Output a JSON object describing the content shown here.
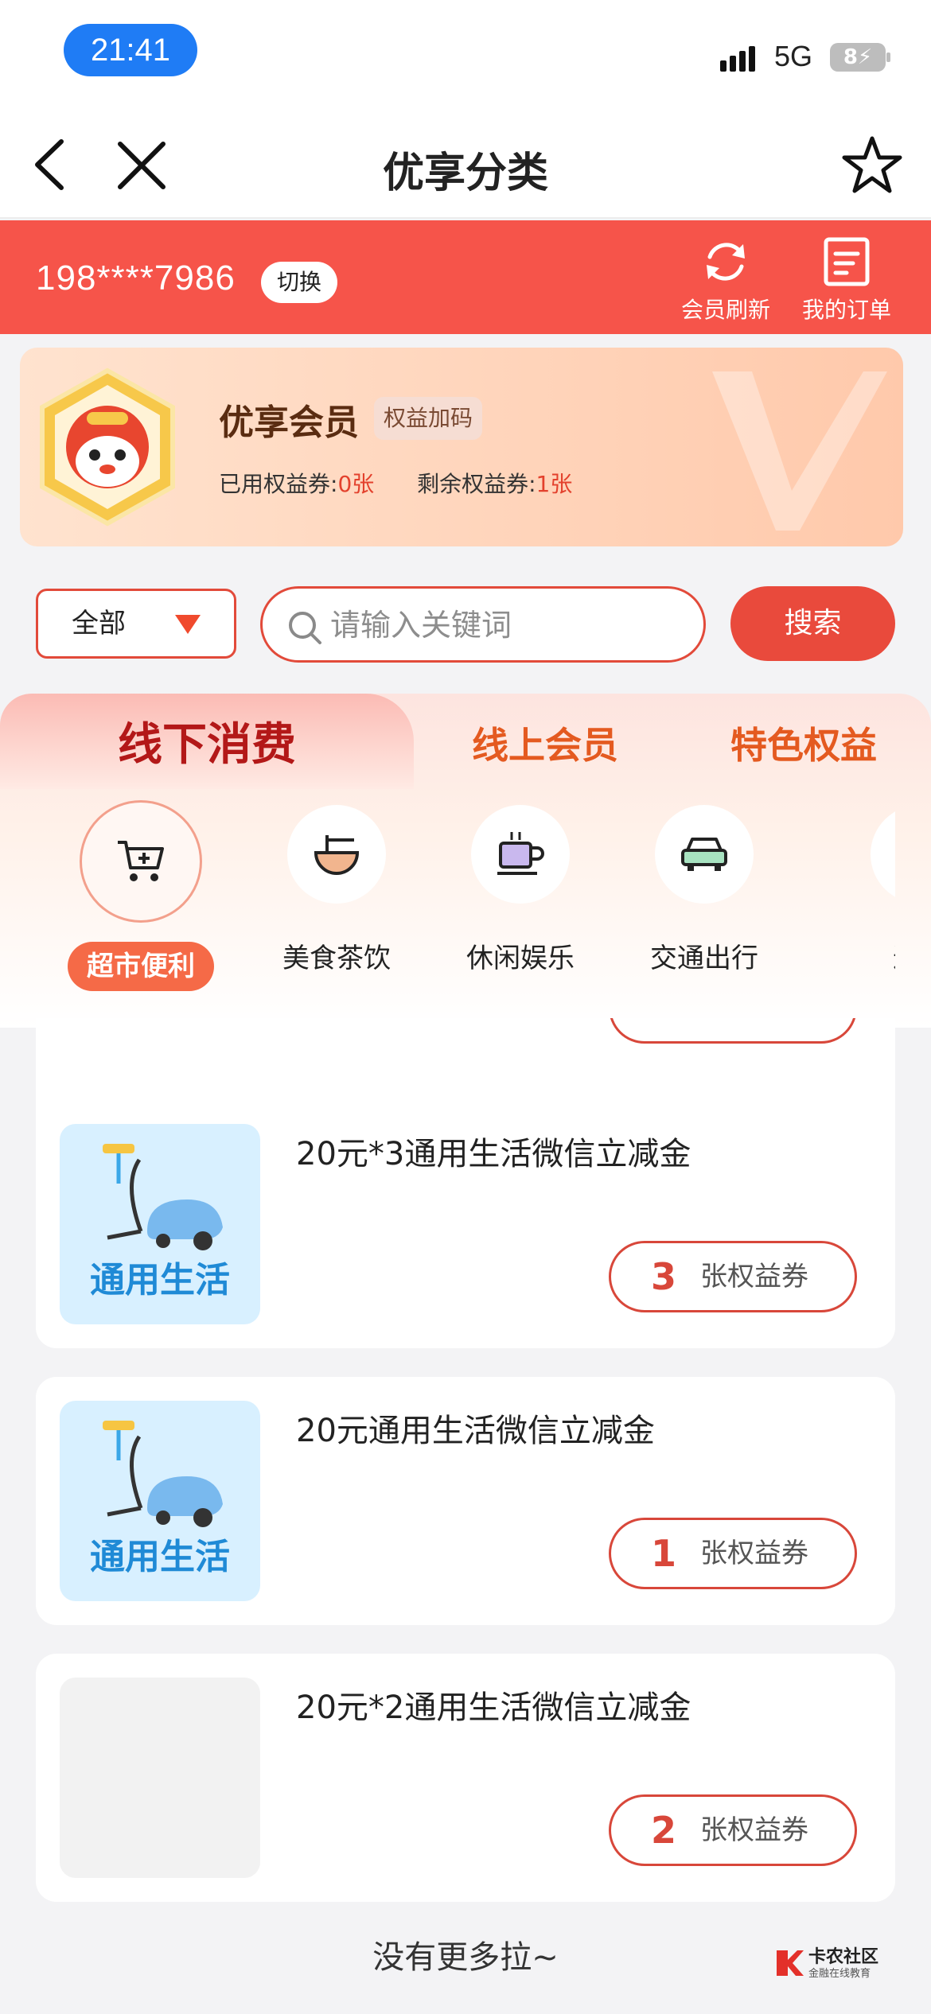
{
  "status": {
    "time": "21:41",
    "network": "5G",
    "battery": "8"
  },
  "nav": {
    "title": "优享分类"
  },
  "member_bar": {
    "phone": "198****7986",
    "switch_label": "切换",
    "refresh_label": "会员刷新",
    "orders_label": "我的订单"
  },
  "member_card": {
    "title": "优享会员",
    "tag": "权益加码",
    "used_label": "已用权益券:",
    "used_value": "0张",
    "remaining_label": "剩余权益券:",
    "remaining_value": "1张"
  },
  "filter": {
    "selected": "全部"
  },
  "search": {
    "placeholder": "请输入关键词",
    "button_label": "搜索"
  },
  "tabs": [
    "线下消费",
    "线上会员",
    "特色权益"
  ],
  "categories": [
    "超市便利",
    "美食茶饮",
    "休闲娱乐",
    "交通出行",
    "进店"
  ],
  "items": [
    {
      "title": "20元*3通用生活微信立减金",
      "thumb_label": "通用生活",
      "count": "3",
      "unit": "张权益券"
    },
    {
      "title": "20元通用生活微信立减金",
      "thumb_label": "通用生活",
      "count": "1",
      "unit": "张权益券"
    },
    {
      "title": "20元*2通用生活微信立减金",
      "thumb_label": "",
      "count": "2",
      "unit": "张权益券"
    }
  ],
  "footer": {
    "end_text": "没有更多拉~"
  },
  "watermark": {
    "title": "卡农社区",
    "subtitle": "金融在线教育"
  },
  "colors": {
    "primary_red": "#f6544a",
    "accent_orange": "#f56a47",
    "status_blue": "#1f7cf5"
  }
}
